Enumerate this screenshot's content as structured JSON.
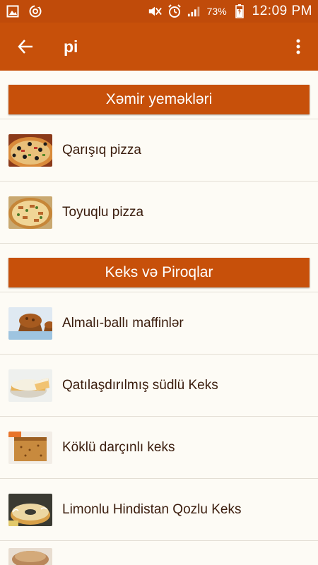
{
  "status": {
    "battery": "73%",
    "time": "12:09 PM"
  },
  "app_bar": {
    "query": "pi"
  },
  "sections": [
    {
      "title": "Xəmir yeməkləri",
      "items": [
        {
          "label": "Qarışıq pizza",
          "thumb": "mixed-pizza"
        },
        {
          "label": "Toyuqlu pizza",
          "thumb": "chicken-pizza"
        }
      ]
    },
    {
      "title": "Keks və Piroqlar",
      "items": [
        {
          "label": "Almalı-ballı maffinlər",
          "thumb": "apple-honey-muffins"
        },
        {
          "label": "Qatılaşdırılmış südlü Keks",
          "thumb": "condensed-milk-cake"
        },
        {
          "label": "Köklü darçınlı keks",
          "thumb": "carrot-cinnamon-cake"
        },
        {
          "label": "Limonlu Hindistan Qozlu Keks",
          "thumb": "lemon-coconut-cake"
        }
      ]
    }
  ],
  "colors": {
    "primary": "#c7500a",
    "status_bar": "#c04b0a",
    "background": "#fdfbf5",
    "item_text": "#3a1c0c"
  }
}
